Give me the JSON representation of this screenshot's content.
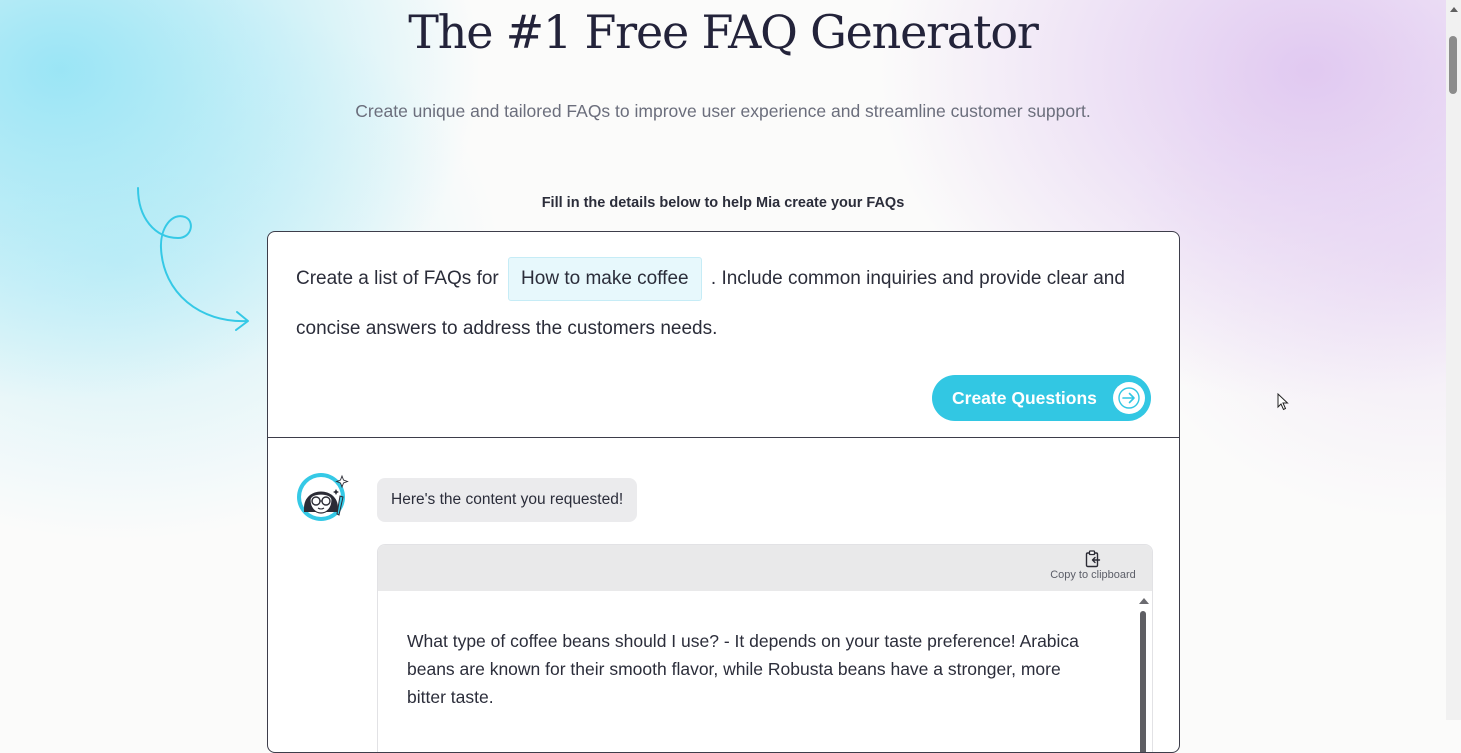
{
  "page": {
    "title": "The #1 Free FAQ Generator",
    "subtitle": "Create unique and tailored FAQs to improve user experience and streamline customer support.",
    "fill_label": "Fill in the details below to help Mia create your FAQs"
  },
  "form": {
    "prompt_before": "Create a list of FAQs for",
    "topic_value": "How to make coffee",
    "prompt_after": ". Include common inquiries and provide clear and concise answers to address the customers needs.",
    "button_label": "Create Questions"
  },
  "chat": {
    "bot_message": "Here's the content you requested!",
    "copy_label": "Copy to clipboard",
    "result_text": "What type of coffee beans should I use? - It depends on your taste preference! Arabica beans are known for their smooth flavor, while Robusta beans have a stronger, more bitter taste."
  },
  "icons": {
    "swirl": "curly-arrow-icon",
    "button_arrow": "arrow-right-icon",
    "avatar": "mia-avatar",
    "copy": "clipboard-icon",
    "cursor": "mouse-pointer-icon"
  },
  "colors": {
    "accent": "#32c7e3",
    "title": "#23233a",
    "topic_bg": "#e7f8fc"
  }
}
